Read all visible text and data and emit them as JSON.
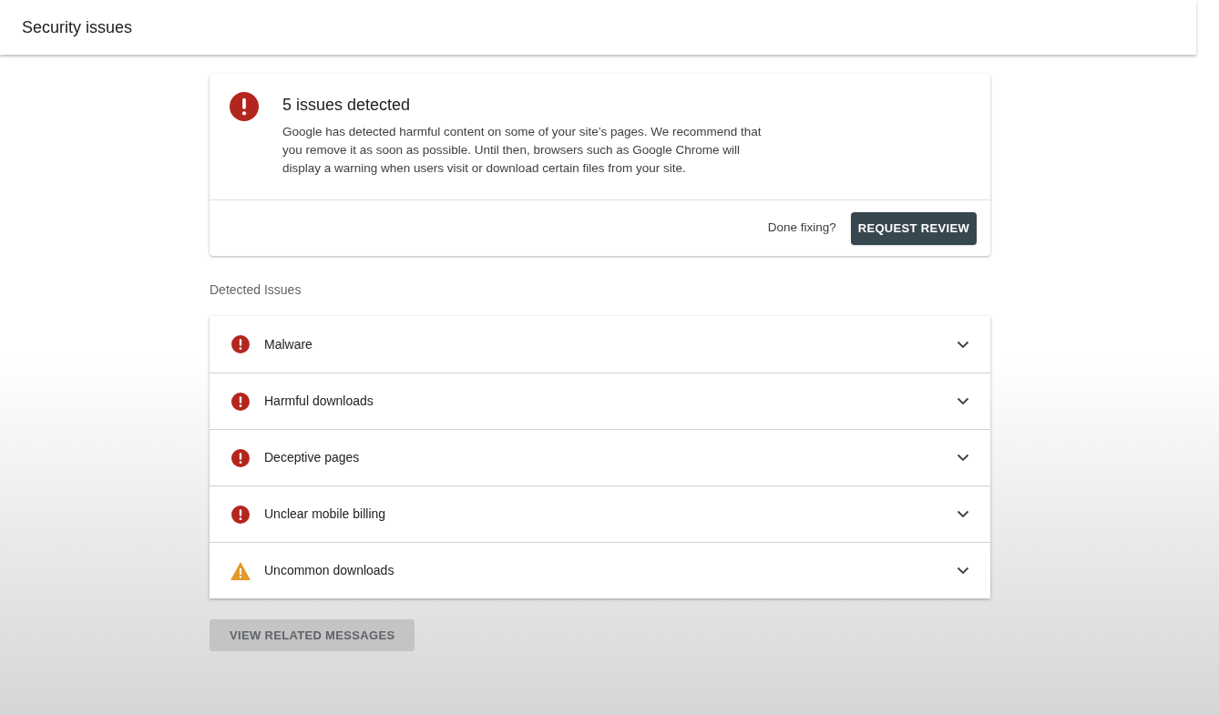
{
  "header": {
    "title": "Security issues"
  },
  "summary": {
    "title": "5 issues detected",
    "description": "Google has detected harmful content on some of your site’s pages. We recommend that you remove it as soon as possible. Until then, browsers such as Google Chrome will display a warning when users visit or download certain files from your site.",
    "prompt": "Done fixing?",
    "button": "REQUEST REVIEW"
  },
  "section_label": "Detected Issues",
  "issues": [
    {
      "label": "Malware",
      "kind": "error",
      "expanded": false
    },
    {
      "label": "Harmful downloads",
      "kind": "error",
      "expanded": false
    },
    {
      "label": "Deceptive pages",
      "kind": "error",
      "expanded": false
    },
    {
      "label": "Unclear mobile billing",
      "kind": "error",
      "expanded": false
    },
    {
      "label": "Uncommon downloads",
      "kind": "warning",
      "expanded": false
    }
  ],
  "related_button": {
    "label": "VIEW RELATED MESSAGES",
    "disabled": true
  }
}
